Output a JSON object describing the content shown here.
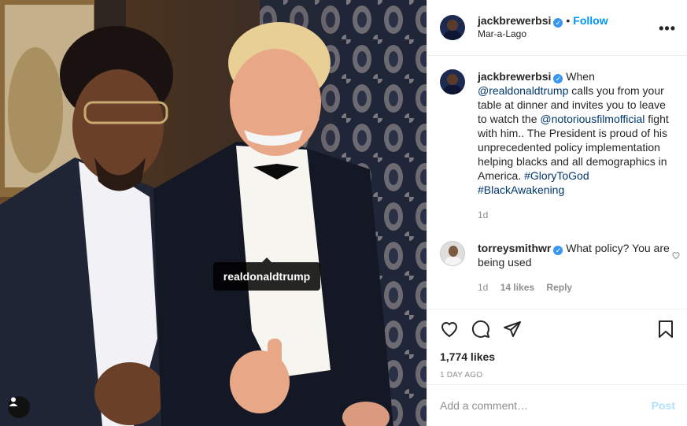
{
  "photo": {
    "tag_label": "realdonaldtrump",
    "tag_button_icon": "user-tag-icon"
  },
  "header": {
    "username": "jackbrewerbsi",
    "verified_icon": "verified-badge-icon",
    "separator": "•",
    "follow_label": "Follow",
    "location": "Mar-a-Lago",
    "more_icon": "more-options-icon"
  },
  "caption": {
    "username": "jackbrewerbsi",
    "text_1": "When",
    "mention_1": "@realdonaldtrump",
    "text_2": "calls you from your table at dinner and invites you to leave to watch the",
    "mention_2": "@notoriousfilmofficial",
    "text_3": "fight with him.. The President is proud of his unprecedented policy implementation helping blacks and all demographics in America.",
    "hashtag_1": "#GloryToGod",
    "hashtag_2": "#BlackAwakening",
    "time": "1d"
  },
  "comment": {
    "username": "torreysmithwr",
    "text": "What policy? You are being used",
    "time": "1d",
    "likes": "14 likes",
    "reply_label": "Reply"
  },
  "actions": {
    "likes": "1,774 likes",
    "posted_ago": "1 DAY AGO"
  },
  "add_comment": {
    "placeholder": "Add a comment…",
    "post_label": "Post"
  },
  "colors": {
    "link": "#00376b",
    "follow": "#0095f6",
    "verified": "#3897f0",
    "post_disabled": "#b2dffc"
  }
}
